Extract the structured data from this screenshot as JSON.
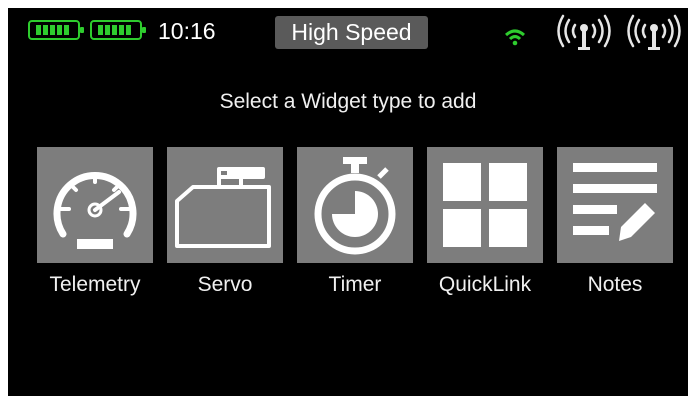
{
  "status_bar": {
    "time": "10:16",
    "mode": "High Speed",
    "battery_color": "#2ecc2e",
    "wifi_color": "#2ecc2e",
    "icons": [
      "battery-icon",
      "battery-icon",
      "wifi-icon",
      "antenna-signal-icon",
      "antenna-signal-icon"
    ]
  },
  "prompt": "Select a Widget type to add",
  "widgets": [
    {
      "label": "Telemetry",
      "icon": "speedometer-icon"
    },
    {
      "label": "Servo",
      "icon": "servo-icon"
    },
    {
      "label": "Timer",
      "icon": "stopwatch-icon"
    },
    {
      "label": "QuickLink",
      "icon": "grid-icon"
    },
    {
      "label": "Notes",
      "icon": "notes-icon"
    }
  ],
  "colors": {
    "background": "#000000",
    "tile": "#7d7d7d",
    "text": "#f0f0f0"
  }
}
